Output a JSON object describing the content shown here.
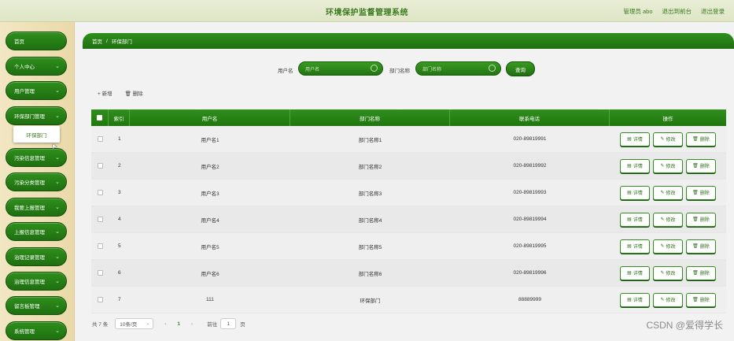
{
  "header": {
    "title": "环境保护监督管理系统",
    "user_label": "管理员 abo",
    "back_label": "退出到前台",
    "logout_label": "退出登录"
  },
  "sidebar": {
    "items": [
      {
        "label": "首页",
        "has_chevron": false
      },
      {
        "label": "个人中心",
        "has_chevron": true
      },
      {
        "label": "用户管理",
        "has_chevron": true
      },
      {
        "label": "环保部门管理",
        "has_chevron": true
      },
      {
        "label": "污染信息管理",
        "has_chevron": true
      },
      {
        "label": "污染分类管理",
        "has_chevron": true
      },
      {
        "label": "我要上报管理",
        "has_chevron": true
      },
      {
        "label": "上报信息管理",
        "has_chevron": true
      },
      {
        "label": "治理记录管理",
        "has_chevron": true
      },
      {
        "label": "治理信息管理",
        "has_chevron": true
      },
      {
        "label": "留言板管理",
        "has_chevron": true
      },
      {
        "label": "系统管理",
        "has_chevron": true
      }
    ],
    "submenu": "环保部门"
  },
  "breadcrumb": {
    "home": "首页",
    "sep": "/",
    "current": "环保部门"
  },
  "search": {
    "username_label": "用户名",
    "username_placeholder": "用户名",
    "dept_label": "部门名称",
    "dept_placeholder": "部门名称",
    "button": "查询"
  },
  "actions": {
    "add": "+ 新增",
    "delete": "🗑 删除"
  },
  "table": {
    "columns": [
      "索引",
      "用户名",
      "部门名称",
      "联系电话",
      "操作"
    ],
    "rows": [
      {
        "index": "1",
        "user": "用户名1",
        "dept": "部门名称1",
        "phone": "020-89819991"
      },
      {
        "index": "2",
        "user": "用户名2",
        "dept": "部门名称2",
        "phone": "020-89819992"
      },
      {
        "index": "3",
        "user": "用户名3",
        "dept": "部门名称3",
        "phone": "020-89819993"
      },
      {
        "index": "4",
        "user": "用户名4",
        "dept": "部门名称4",
        "phone": "020-89819994"
      },
      {
        "index": "5",
        "user": "用户名5",
        "dept": "部门名称5",
        "phone": "020-89819995"
      },
      {
        "index": "6",
        "user": "用户名6",
        "dept": "部门名称6",
        "phone": "020-89819996"
      },
      {
        "index": "7",
        "user": "111",
        "dept": "环保部门",
        "phone": "88889999"
      }
    ],
    "ops": {
      "detail": "详情",
      "edit": "修改",
      "delete": "删除"
    }
  },
  "pager": {
    "total": "共 7 条",
    "page_size": "10条/页",
    "prev": "‹",
    "current": "1",
    "next": "›",
    "goto": "前往",
    "goto_value": "1",
    "unit": "页"
  },
  "watermark": "CSDN @爱得学长",
  "colors": {
    "primary": "#2f8f1c",
    "dark": "#164f0b",
    "title": "#3a7a1c"
  }
}
